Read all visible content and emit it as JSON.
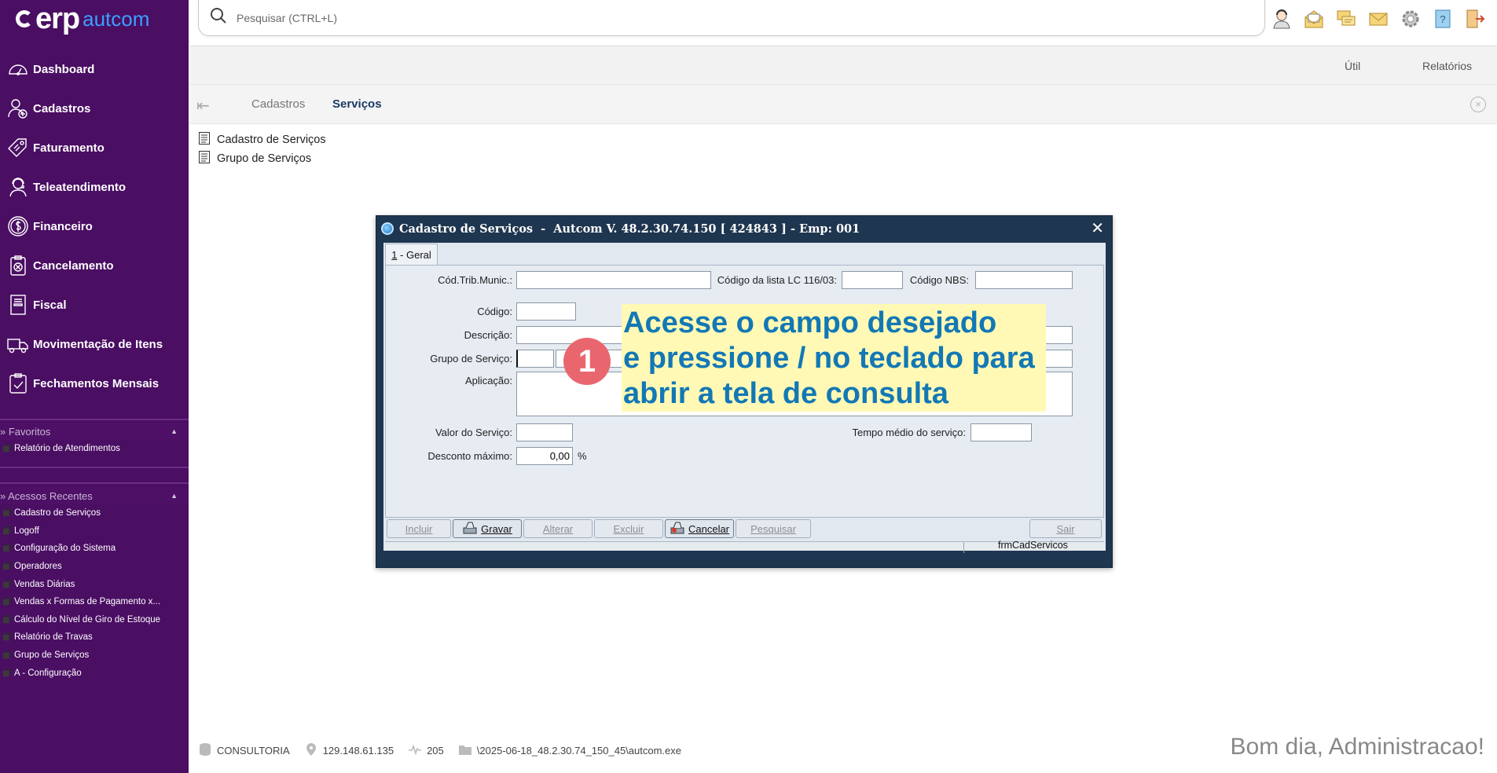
{
  "app": {
    "logo_main": "erp",
    "logo_brand": "autcom"
  },
  "sidebar": {
    "items": [
      {
        "label": "Dashboard",
        "icon": "dashboard-icon"
      },
      {
        "label": "Cadastros",
        "icon": "user-add-icon"
      },
      {
        "label": "Faturamento",
        "icon": "price-tag-icon"
      },
      {
        "label": "Teleatendimento",
        "icon": "headset-icon"
      },
      {
        "label": "Financeiro",
        "icon": "dollar-icon"
      },
      {
        "label": "Cancelamento",
        "icon": "cancel-clipboard-icon"
      },
      {
        "label": "Fiscal",
        "icon": "document-icon"
      },
      {
        "label": "Movimentação de Itens",
        "icon": "truck-icon"
      },
      {
        "label": "Fechamentos Mensais",
        "icon": "checklist-icon"
      }
    ],
    "favorites": {
      "title": "» Favoritos",
      "items": [
        "Relatório de Atendimentos"
      ]
    },
    "recent": {
      "title": "» Acessos Recentes",
      "items": [
        "Cadastro de Serviços",
        "Logoff",
        "Configuração do Sistema",
        "Operadores",
        "Vendas Diárias",
        "Vendas x Formas de Pagamento x...",
        "Cálculo do Nível de Giro de Estoque",
        "Relatório de Travas",
        "Grupo de Serviços",
        "A - Configuração"
      ]
    }
  },
  "search": {
    "placeholder": "Pesquisar (CTRL+L)"
  },
  "top_icons": [
    "operator-icon",
    "mail-open-icon",
    "messages-icon",
    "envelope-icon",
    "settings-icon",
    "help-icon",
    "exit-icon"
  ],
  "menubar": {
    "util": "Útil",
    "reports": "Relatórios"
  },
  "breadcrumb": {
    "parent": "Cadastros",
    "current": "Serviços"
  },
  "files": [
    "Cadastro de Serviços",
    "Grupo de Serviços"
  ],
  "dialog": {
    "title": "Cadastro de Serviços  -  Autcom V. 48.2.30.74.150 [ 424843 ] - Emp: 001",
    "tab_prefix": "1",
    "tab_label": " - Geral",
    "labels": {
      "cod_trib": "Cód.Trib.Munic.:",
      "lc116": "Código da lista LC 116/03:",
      "nbs": "Código NBS:",
      "codigo": "Código:",
      "descricao": "Descrição:",
      "grupo": "Grupo de Serviço:",
      "aplicacao": "Aplicação:",
      "valor": "Valor do Serviço:",
      "tempo": "Tempo médio do serviço:",
      "desconto": "Desconto máximo:",
      "percent": "%"
    },
    "values": {
      "desconto": "0,00"
    },
    "buttons": {
      "incluir": "Incluir",
      "gravar": "Gravar",
      "alterar": "Alterar",
      "excluir": "Excluir",
      "cancelar": "Cancelar",
      "pesquisar": "Pesquisar",
      "sair": "Sair"
    },
    "form_name": "frmCadServicos"
  },
  "callout": {
    "step": "1",
    "lines": [
      "Acesse o campo desejado",
      "e pressione / no teclado para",
      "abrir a tela de consulta"
    ]
  },
  "status": {
    "db": "CONSULTORIA",
    "ip": "129.148.61.135",
    "ping": "205",
    "path": "\\2025-06-18_48.2.30.74_150_45\\autcom.exe",
    "greeting": "Bom dia, Administracao!"
  },
  "colors": {
    "sidebar": "#4a0e63",
    "brand": "#3aa0ff",
    "callout_bg": "#fff9b5",
    "callout_text": "#1378b5",
    "badge": "#e9666e"
  }
}
